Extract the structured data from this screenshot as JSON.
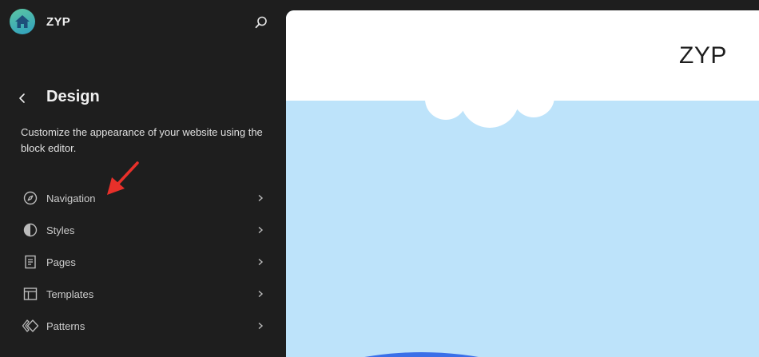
{
  "site": {
    "name": "ZYP"
  },
  "panel": {
    "title": "Design",
    "description": "Customize the appearance of your website using the block editor."
  },
  "nav": {
    "items": [
      {
        "label": "Navigation",
        "icon": "compass-icon"
      },
      {
        "label": "Styles",
        "icon": "half-circle-icon"
      },
      {
        "label": "Pages",
        "icon": "page-icon"
      },
      {
        "label": "Templates",
        "icon": "layout-icon"
      },
      {
        "label": "Patterns",
        "icon": "diamond-icon"
      }
    ]
  },
  "preview": {
    "site_title": "ZYP"
  },
  "colors": {
    "sidebar_bg": "#1e1e1e",
    "sky": "#bde3fa",
    "annotation": "#e8302a",
    "logo_gradient": [
      "#5cc6a2",
      "#2f9fbf"
    ]
  }
}
